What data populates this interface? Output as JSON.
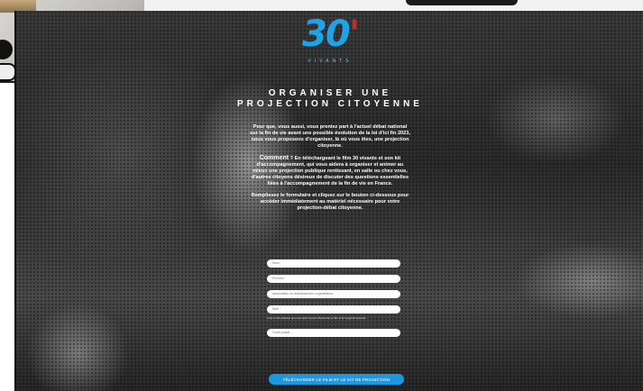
{
  "logo": {
    "number": "30",
    "accent": "'",
    "name": "VIVANTS"
  },
  "heading": {
    "line1": "ORGANISER UNE",
    "line2": "PROJECTION CITOYENNE"
  },
  "intro": {
    "p1": "Pour que, vous aussi, vous preniez part à l'actuel débat national sur la fin de vie avant une possible évolution de la loi d'ici fin 2023, nous vous proposons d'organiser, là où vous êtes, une projection citoyenne.",
    "p2_lead": "Comment",
    "p2": " ? En téléchargeant le film 30 vivants et son kit d'accompagnement, qui vous aidera à organiser et animer au mieux une projection publique rentissant, en salle ou chez vous, d'autres citoyens désireux de discuter des questions essentielles liées à l'accompagnement de la fin de vie en France.",
    "p3": "Remplissez le formulaire et cliquez sur le bouton ci-dessous pour accéder immédiatement au matériel nécessaire pour votre projection-débat citoyenne."
  },
  "form": {
    "nom_placeholder": "Nom",
    "prenom_placeholder": "Prénom",
    "association_placeholder": "Association ou établissement organisateur",
    "mail_placeholder": "Mail",
    "note": "C'est à cette adresse que vous allez recevoir directement le film et les supports associés",
    "code_postal_placeholder": "Code postal",
    "submit_label": "TÉLÉCHARGER LE FILM ET LE KIT DE PROJECTION"
  },
  "colors": {
    "accent": "#1d97e0",
    "logo_blue": "#1ea4e6",
    "logo_red": "#b7312f"
  }
}
